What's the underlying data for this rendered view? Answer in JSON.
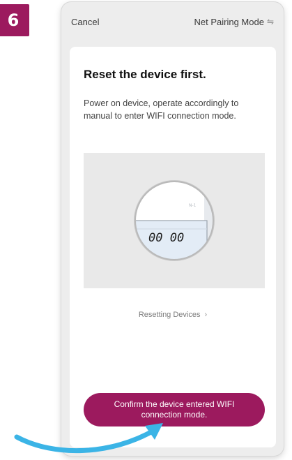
{
  "step": {
    "number": "6"
  },
  "nav": {
    "cancel_label": "Cancel",
    "mode_label": "Net Pairing Mode",
    "mode_icon": "swap-icon"
  },
  "card": {
    "title": "Reset the device first.",
    "description": "Power on device, operate accordingly to manual to enter WIFI connection mode.",
    "device_label": "N-1",
    "display_value": "00 00",
    "reset_link_label": "Resetting Devices",
    "confirm_button_label": "Confirm the device entered WIFI connection mode."
  },
  "colors": {
    "accent": "#9c1a5e",
    "arrow": "#3bb4e6",
    "screen_bg": "#ededed"
  }
}
